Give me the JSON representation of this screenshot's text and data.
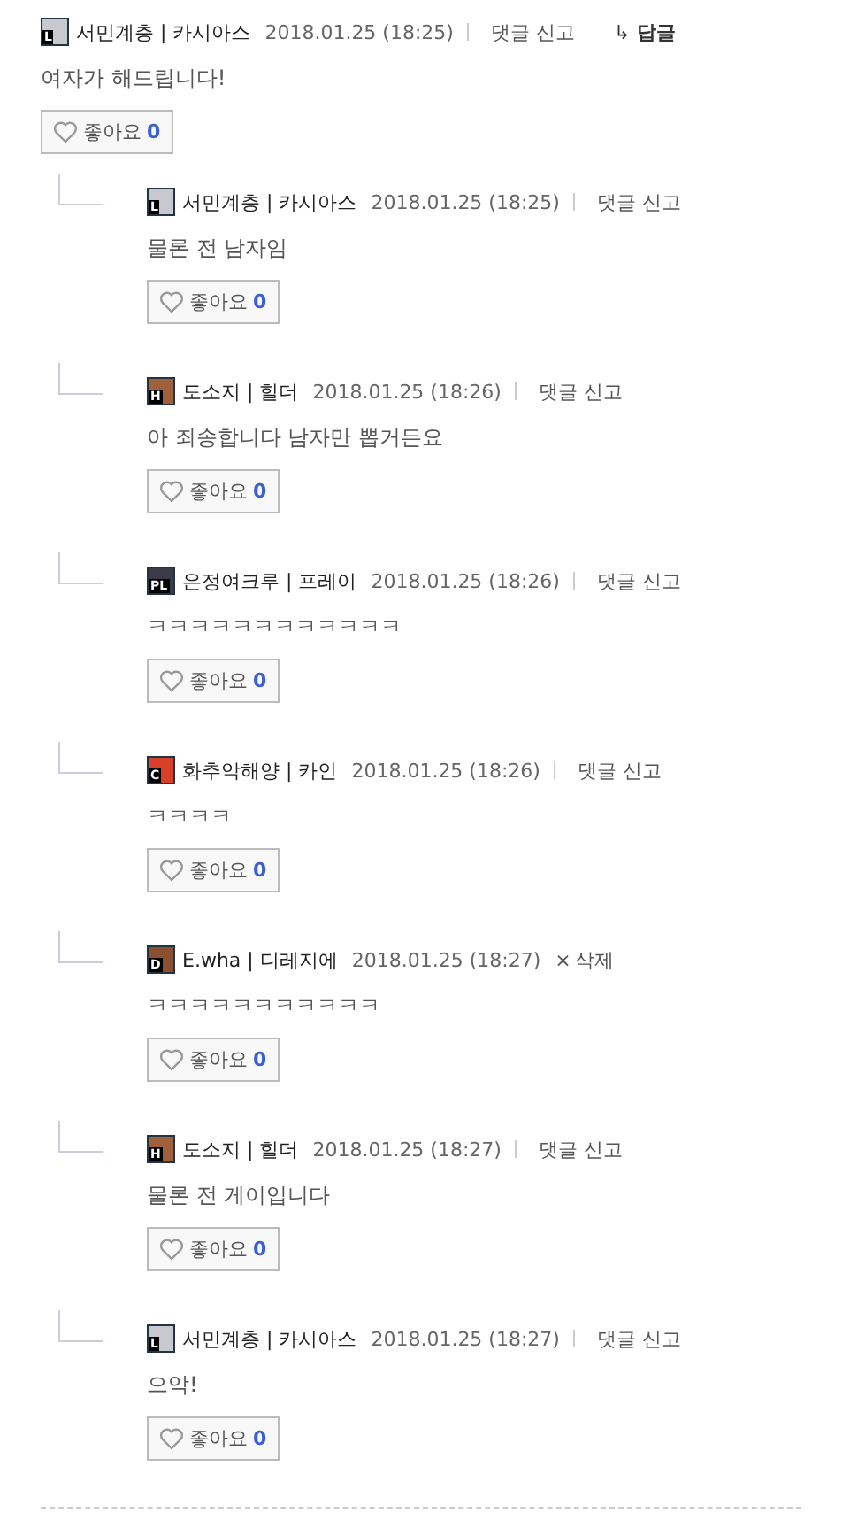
{
  "comment": {
    "avatar": {
      "letter": "L",
      "color": "#c8c8d0"
    },
    "author": "서민계층 | 카시아스",
    "date": "2018.01.25 (18:25)",
    "action": {
      "kind": "report",
      "label": "댓글 신고"
    },
    "reply_link": {
      "icon": "↳",
      "label": "답글"
    },
    "text": "여자가 해드립니다!",
    "like": {
      "label": "좋아요",
      "count": "0"
    }
  },
  "replies": [
    {
      "avatar": {
        "letter": "L",
        "color": "#c8c8d0"
      },
      "author": "서민계층 | 카시아스",
      "date": "2018.01.25 (18:25)",
      "action": {
        "kind": "report",
        "label": "댓글 신고"
      },
      "text": "물론 전 남자임",
      "like": {
        "label": "좋아요",
        "count": "0"
      }
    },
    {
      "avatar": {
        "letter": "H",
        "color": "#a0603a"
      },
      "author": "도소지 | 힐더",
      "date": "2018.01.25 (18:26)",
      "action": {
        "kind": "report",
        "label": "댓글 신고"
      },
      "text": "아 죄송합니다 남자만 뽑거든요",
      "like": {
        "label": "좋아요",
        "count": "0"
      }
    },
    {
      "avatar": {
        "letter": "PL",
        "color": "#3a3a48"
      },
      "author": "은정여크루 | 프레이",
      "date": "2018.01.25 (18:26)",
      "action": {
        "kind": "report",
        "label": "댓글 신고"
      },
      "text": "ㅋㅋㅋㅋㅋㅋㅋㅋㅋㅋㅋㅋ",
      "like": {
        "label": "좋아요",
        "count": "0"
      }
    },
    {
      "avatar": {
        "letter": "C",
        "color": "#d8402a"
      },
      "author": "화추악해양 | 카인",
      "date": "2018.01.25 (18:26)",
      "action": {
        "kind": "report",
        "label": "댓글 신고"
      },
      "text": "ㅋㅋㅋㅋ",
      "like": {
        "label": "좋아요",
        "count": "0"
      }
    },
    {
      "avatar": {
        "letter": "D",
        "color": "#8a5030"
      },
      "author": "E.wha | 디레지에",
      "date": "2018.01.25 (18:27)",
      "action": {
        "kind": "delete",
        "icon": "×",
        "label": "삭제"
      },
      "text": "ㅋㅋㅋㅋㅋㅋㅋㅋㅋㅋㅋ",
      "like": {
        "label": "좋아요",
        "count": "0"
      }
    },
    {
      "avatar": {
        "letter": "H",
        "color": "#a0603a"
      },
      "author": "도소지 | 힐더",
      "date": "2018.01.25 (18:27)",
      "action": {
        "kind": "report",
        "label": "댓글 신고"
      },
      "text": "물론 전 게이입니다",
      "like": {
        "label": "좋아요",
        "count": "0"
      }
    },
    {
      "avatar": {
        "letter": "L",
        "color": "#c8c8d0"
      },
      "author": "서민계층 | 카시아스",
      "date": "2018.01.25 (18:27)",
      "action": {
        "kind": "report",
        "label": "댓글 신고"
      },
      "text": "으악!",
      "like": {
        "label": "좋아요",
        "count": "0"
      }
    }
  ]
}
